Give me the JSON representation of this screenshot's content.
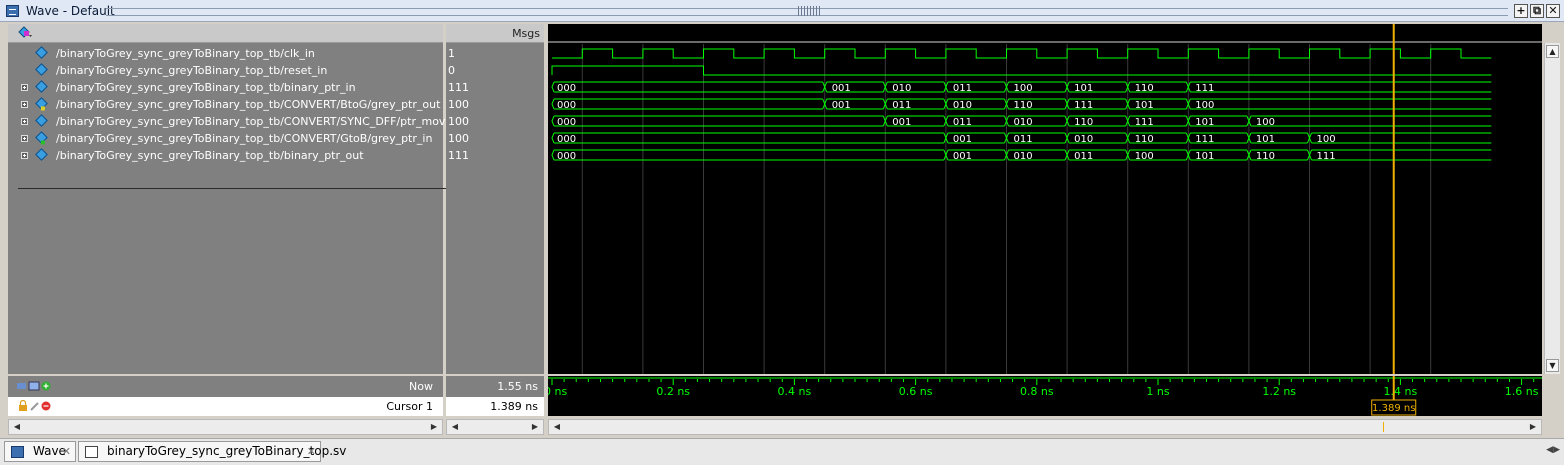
{
  "window": {
    "title": "Wave - Default",
    "buttons": [
      "+",
      "⧉",
      "✕"
    ]
  },
  "header": {
    "values_column": "Msgs"
  },
  "signals": [
    {
      "name": "/binaryToGrey_sync_greyToBinary_top_tb/clk_in",
      "value": "1",
      "expandable": false,
      "kind": "in"
    },
    {
      "name": "/binaryToGrey_sync_greyToBinary_top_tb/reset_in",
      "value": "0",
      "expandable": false,
      "kind": "in"
    },
    {
      "name": "/binaryToGrey_sync_greyToBinary_top_tb/binary_ptr_in",
      "value": "111",
      "expandable": true,
      "kind": "in"
    },
    {
      "name": "/binaryToGrey_sync_greyToBinary_top_tb/CONVERT/BtoG/grey_ptr_out",
      "value": "100",
      "expandable": true,
      "kind": "out"
    },
    {
      "name": "/binaryToGrey_sync_greyToBinary_top_tb/CONVERT/SYNC_DFF/ptr_move",
      "value": "100",
      "expandable": true,
      "kind": "in"
    },
    {
      "name": "/binaryToGrey_sync_greyToBinary_top_tb/CONVERT/GtoB/grey_ptr_in",
      "value": "100",
      "expandable": true,
      "kind": "inport"
    },
    {
      "name": "/binaryToGrey_sync_greyToBinary_top_tb/binary_ptr_out",
      "value": "111",
      "expandable": true,
      "kind": "in"
    }
  ],
  "bus_waves": [
    {
      "initial": "000",
      "segments": [
        {
          "t": 0.45,
          "v": "001"
        },
        {
          "t": 0.55,
          "v": "010"
        },
        {
          "t": 0.65,
          "v": "011"
        },
        {
          "t": 0.75,
          "v": "100"
        },
        {
          "t": 0.85,
          "v": "101"
        },
        {
          "t": 0.95,
          "v": "110"
        },
        {
          "t": 1.05,
          "v": "111"
        }
      ]
    },
    {
      "initial": "000",
      "segments": [
        {
          "t": 0.45,
          "v": "001"
        },
        {
          "t": 0.55,
          "v": "011"
        },
        {
          "t": 0.65,
          "v": "010"
        },
        {
          "t": 0.75,
          "v": "110"
        },
        {
          "t": 0.85,
          "v": "111"
        },
        {
          "t": 0.95,
          "v": "101"
        },
        {
          "t": 1.05,
          "v": "100"
        }
      ]
    },
    {
      "initial": "000",
      "segments": [
        {
          "t": 0.55,
          "v": "001"
        },
        {
          "t": 0.65,
          "v": "011"
        },
        {
          "t": 0.75,
          "v": "010"
        },
        {
          "t": 0.85,
          "v": "110"
        },
        {
          "t": 0.95,
          "v": "111"
        },
        {
          "t": 1.05,
          "v": "101"
        },
        {
          "t": 1.15,
          "v": "100"
        }
      ]
    },
    {
      "initial": "000",
      "segments": [
        {
          "t": 0.65,
          "v": "001"
        },
        {
          "t": 0.75,
          "v": "011"
        },
        {
          "t": 0.85,
          "v": "010"
        },
        {
          "t": 0.95,
          "v": "110"
        },
        {
          "t": 1.05,
          "v": "111"
        },
        {
          "t": 1.15,
          "v": "101"
        },
        {
          "t": 1.25,
          "v": "100"
        }
      ]
    },
    {
      "initial": "000",
      "segments": [
        {
          "t": 0.65,
          "v": "001"
        },
        {
          "t": 0.75,
          "v": "010"
        },
        {
          "t": 0.85,
          "v": "011"
        },
        {
          "t": 0.95,
          "v": "100"
        },
        {
          "t": 1.05,
          "v": "101"
        },
        {
          "t": 1.15,
          "v": "110"
        },
        {
          "t": 1.25,
          "v": "111"
        }
      ]
    }
  ],
  "clock": {
    "period": 0.1,
    "first_rise": 0.05,
    "high_first": false,
    "end": 1.55
  },
  "reset": {
    "release": 0.25
  },
  "timeline": {
    "start": 0.0,
    "end": 1.64,
    "ticks": [
      {
        "t": 0.0,
        "label": "0 ns"
      },
      {
        "t": 0.2,
        "label": "0.2 ns"
      },
      {
        "t": 0.4,
        "label": "0.4 ns"
      },
      {
        "t": 0.6,
        "label": "0.6 ns"
      },
      {
        "t": 0.8,
        "label": "0.8 ns"
      },
      {
        "t": 1.0,
        "label": "1 ns"
      },
      {
        "t": 1.2,
        "label": "1.2 ns"
      },
      {
        "t": 1.4,
        "label": "1.4 ns"
      },
      {
        "t": 1.6,
        "label": "1.6 ns"
      }
    ]
  },
  "status": {
    "now_label": "Now",
    "now_value": "1.55 ns",
    "cursor_label": "Cursor 1",
    "cursor_value": "1.389 ns",
    "cursor_time": 1.389,
    "cursor_tag": "1.389 ns"
  },
  "colors": {
    "wave": "#00ff00",
    "cursor": "#f0b000",
    "grid": "#3a3a3a"
  },
  "tabs": [
    {
      "label": "Wave",
      "icon": "wave-icon"
    },
    {
      "label": "binaryToGrey_sync_greyToBinary_top.sv",
      "icon": "document-icon"
    }
  ]
}
